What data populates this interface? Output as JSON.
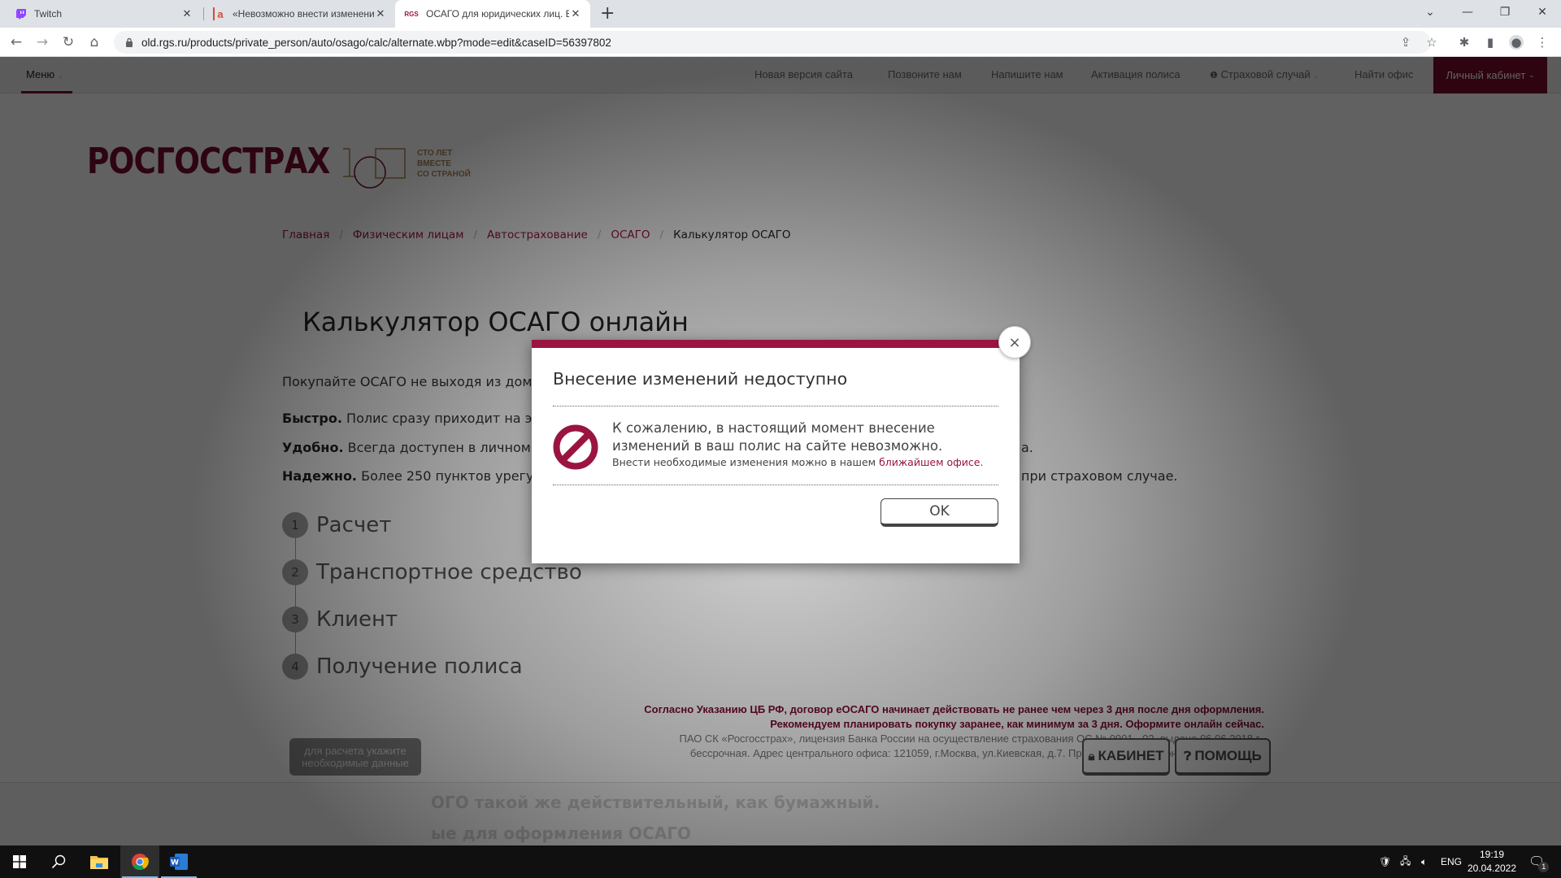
{
  "browser": {
    "tabs": [
      {
        "title": "Twitch",
        "favicon": "twitch-icon",
        "active": false
      },
      {
        "title": "«Невозможно внести изменения",
        "favicon": "irecommend-icon",
        "active": false
      },
      {
        "title": "ОСАГО для юридических лиц. В",
        "favicon": "rgs-icon",
        "favicon_text": "RGS",
        "active": true
      }
    ],
    "new_tab_label": "+",
    "url": "old.rgs.ru/products/private_person/auto/osago/calc/alternate.wbp?mode=edit&caseID=56397802"
  },
  "site_nav": {
    "menu_label": "Меню",
    "links": [
      {
        "label": "Новая версия сайта",
        "style": "new"
      },
      {
        "label": "Позвоните нам"
      },
      {
        "label": "Напишите нам"
      },
      {
        "label": "Активация полиса"
      },
      {
        "label": "Страховой случай",
        "style": "case"
      },
      {
        "label": "Найти офис"
      }
    ],
    "cabinet_label": "Личный кабинет"
  },
  "logo": {
    "brand": "РОСГОССТРАХ",
    "anniversary_number": "100",
    "slogan": [
      "СТО ЛЕТ",
      "ВМЕСТЕ",
      "СО СТРАНОЙ"
    ]
  },
  "breadcrumb": [
    {
      "label": "Главная"
    },
    {
      "label": "Физическим лицам"
    },
    {
      "label": "Автострахование"
    },
    {
      "label": "ОСАГО"
    },
    {
      "label": "Калькулятор ОСАГО",
      "current": true
    }
  ],
  "page": {
    "title": "Калькулятор ОСАГО онлайн",
    "intro": "Покупайте ОСАГО не выходя из дома!",
    "benefits": [
      {
        "bold": "Быстро.",
        "text": " Полис сразу приходит на элект"
      },
      {
        "bold": "Удобно.",
        "text": " Всегда доступен в личном каб",
        "tail": "а."
      },
      {
        "bold": "Надежно.",
        "text": " Более 250 пунктов урегулир",
        "tail": "при страховом случае."
      }
    ],
    "steps": [
      {
        "num": "1",
        "label": "Расчет"
      },
      {
        "num": "2",
        "label": "Транспортное средство"
      },
      {
        "num": "3",
        "label": "Клиент"
      },
      {
        "num": "4",
        "label": "Получение полиса"
      }
    ],
    "notice_red": [
      "Согласно Указанию ЦБ РФ, договор еОСАГО начинает действовать не ранее чем через 3 дня после дня оформления.",
      "Рекомендуем планировать покупку заранее, как минимум за 3 дня. Оформите онлайн сейчас."
    ],
    "notice_grey": "ПАО СК «Росгосстрах», лицензия Банка России на осуществление страхования ОС № 0001 - 03, выдана 06.06.2018 г., бессрочная. Адрес центрального офиса: 121059, г.Москва, ул.Киевская, д.7. При оплате полиса онлайн комиссия не взимается.",
    "faded_lines": [
      "ОГО такой же действительный, как бумажный.",
      "ые для оформления ОСАГО"
    ]
  },
  "bottom_bar": {
    "calc_hint": "для расчета укажите необходимые данные",
    "cabinet_button": "КАБИНЕТ",
    "help_button": "ПОМОЩЬ"
  },
  "modal": {
    "title": "Внесение изменений недоступно",
    "message": "К сожалению, в настоящий момент внесение изменений в ваш полис на сайте невозможно.",
    "sub_text": "Внести необходимые изменения можно в нашем ",
    "sub_link": "ближайшем офисе",
    "sub_end": ".",
    "ok_label": "OK",
    "close_label": "×",
    "accent_color": "#9b1440"
  },
  "taskbar": {
    "language": "ENG",
    "time": "19:19",
    "date": "20.04.2022",
    "notification_count": "1"
  },
  "colors": {
    "brand": "#7a0a2b",
    "link": "#9b1440",
    "gold": "#a88354"
  }
}
